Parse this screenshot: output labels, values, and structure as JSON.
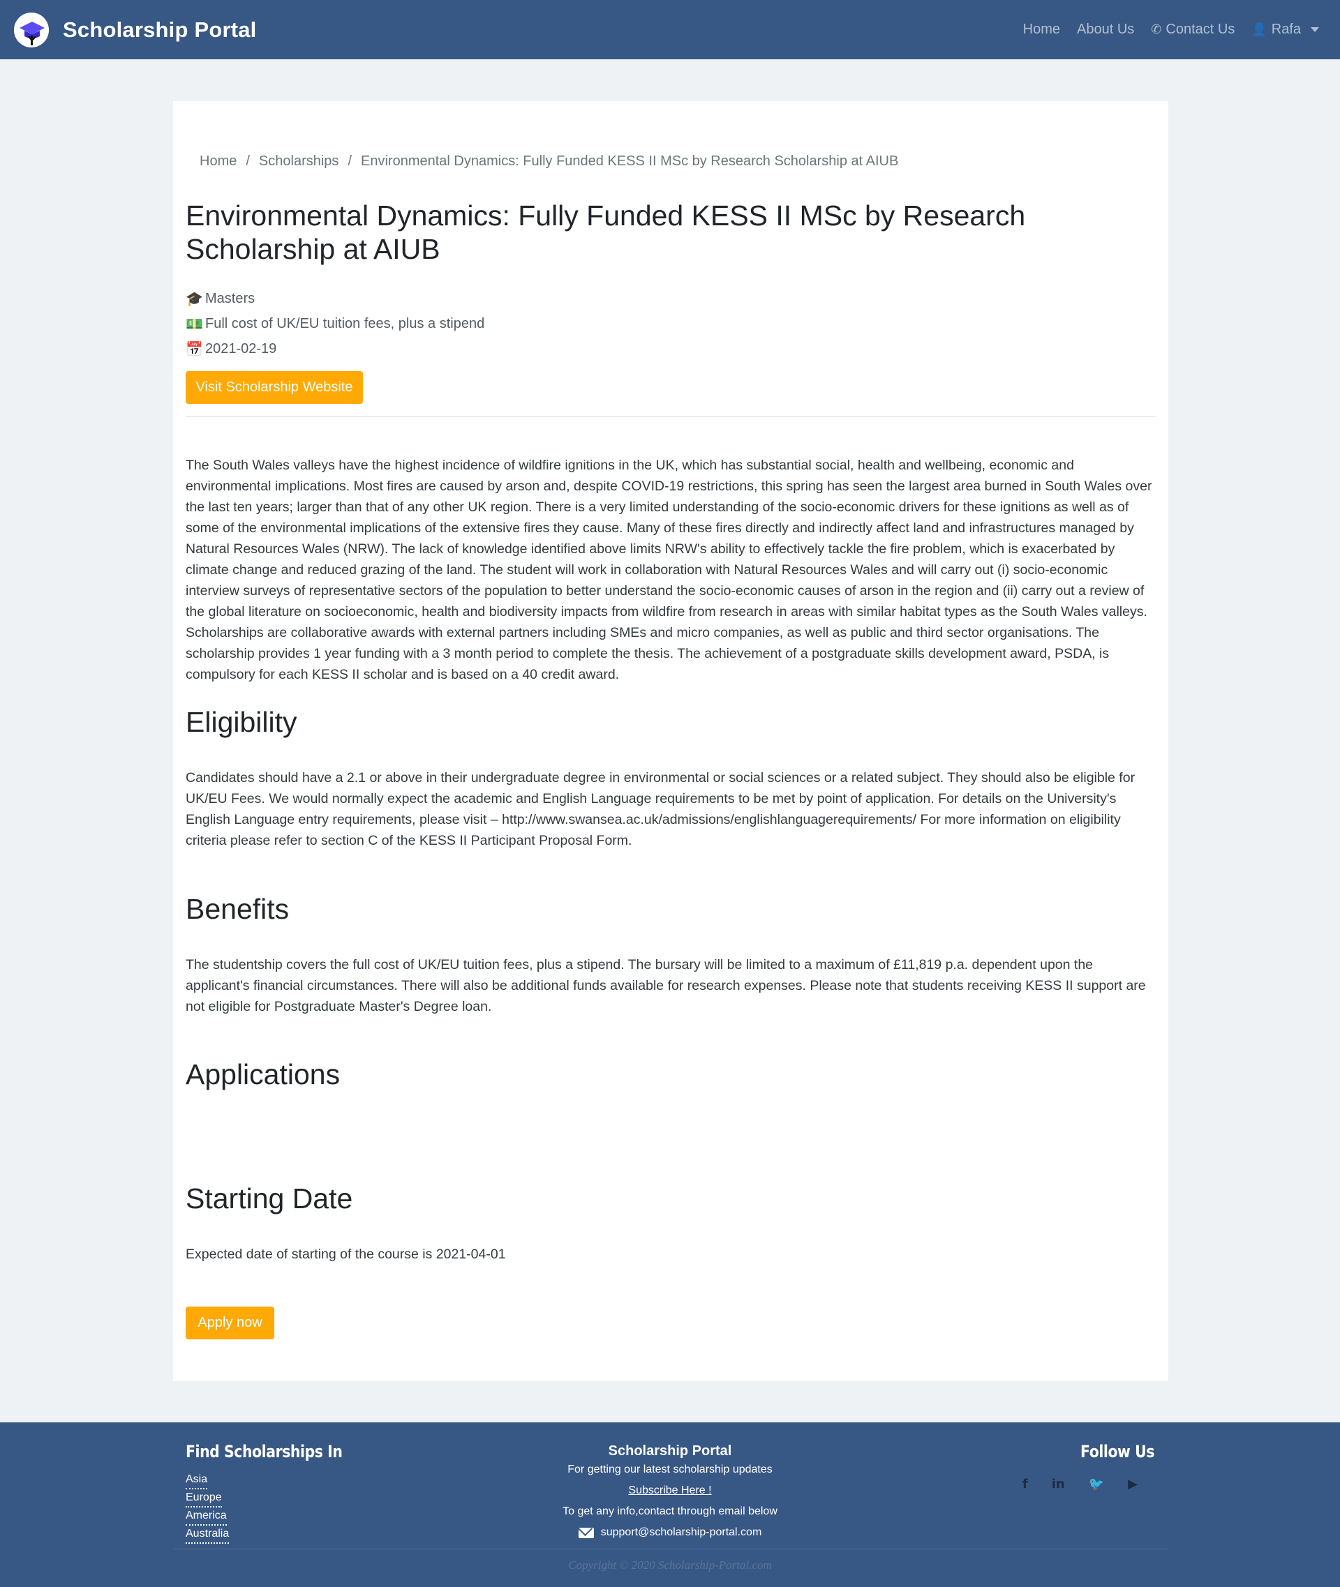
{
  "nav": {
    "brand": "Scholarship Portal",
    "links": [
      "Home",
      "About Us",
      "Contact Us"
    ],
    "user": "Rafa"
  },
  "breadcrumb": [
    "Home",
    "Scholarships",
    "Environmental Dynamics: Fully Funded KESS II MSc by Research Scholarship at AIUB"
  ],
  "scholarship": {
    "title": "Environmental Dynamics: Fully Funded KESS II MSc by Research Scholarship at AIUB",
    "level": "Masters",
    "funding": "Full cost of UK/EU tuition fees, plus a stipend",
    "deadline": "2021-02-19",
    "visit_label": "Visit Scholarship Website",
    "description": "The South Wales valleys have the highest incidence of wildfire ignitions in the UK, which has substantial social, health and wellbeing, economic and environmental implications. Most fires are caused by arson and, despite COVID-19 restrictions, this spring has seen the largest area burned in South Wales over the last ten years; larger than that of any other UK region. There is a very limited understanding of the socio-economic drivers for these ignitions as well as of some of the environmental implications of the extensive fires they cause. Many of these fires directly and indirectly affect land and infrastructures managed by Natural Resources Wales (NRW). The lack of knowledge identified above limits NRW's ability to effectively tackle the fire problem, which is exacerbated by climate change and reduced grazing of the land. The student will work in collaboration with Natural Resources Wales and will carry out (i) socio-economic interview surveys of representative sectors of the population to better understand the socio-economic causes of arson in the region and (ii) carry out a review of the global literature on socioeconomic, health and biodiversity impacts from wildfire from research in areas with similar habitat types as the South Wales valleys. Scholarships are collaborative awards with external partners including SMEs and micro companies, as well as public and third sector organisations. The scholarship provides 1 year funding with a 3 month period to complete the thesis. The achievement of a postgraduate skills development award, PSDA, is compulsory for each KESS II scholar and is based on a 40 credit award.",
    "eligibility_heading": "Eligibility",
    "eligibility": "Candidates should have a 2.1 or above in their undergraduate degree in environmental or social sciences or a related subject. They should also be eligible for UK/EU Fees. We would normally expect the academic and English Language requirements to be met by point of application. For details on the University's English Language entry requirements, please visit – http://www.swansea.ac.uk/admissions/englishlanguagerequirements/ For more information on eligibility criteria please refer to section C of the KESS II Participant Proposal Form.",
    "benefits_heading": "Benefits",
    "benefits": "The studentship covers the full cost of UK/EU tuition fees, plus a stipend. The bursary will be limited to a maximum of £11,819 p.a. dependent upon the applicant's financial circumstances. There will also be additional funds available for research expenses. Please note that students receiving KESS II support are not eligible for Postgraduate Master's Degree loan.",
    "applications_heading": "Applications",
    "start_heading": "Starting Date",
    "start_text": "Expected date of starting of the course is 2021-04-01",
    "apply_label": "Apply now"
  },
  "footer": {
    "find_heading": "Find Scholarships In",
    "regions": [
      "Asia",
      "Europe",
      "America",
      "Australia"
    ],
    "center_title": "Scholarship Portal",
    "updates_text": "For getting our latest scholarship updates",
    "subscribe": "Subscribe Here !",
    "contact_text": "To get any info,contact through email below",
    "email": "support@scholarship-portal.com",
    "follow_heading": "Follow Us",
    "copyright": "Copyright © 2020 Scholarship-Portal.com"
  },
  "colors": {
    "navbar": "#375785",
    "accent": "#ffa906",
    "background": "#eef2f5"
  },
  "icons": [
    "graduation-cap-icon",
    "money-icon",
    "calendar-icon",
    "phone-icon",
    "user-icon",
    "facebook-icon",
    "linkedin-icon",
    "twitter-icon",
    "youtube-icon",
    "envelope-icon"
  ]
}
